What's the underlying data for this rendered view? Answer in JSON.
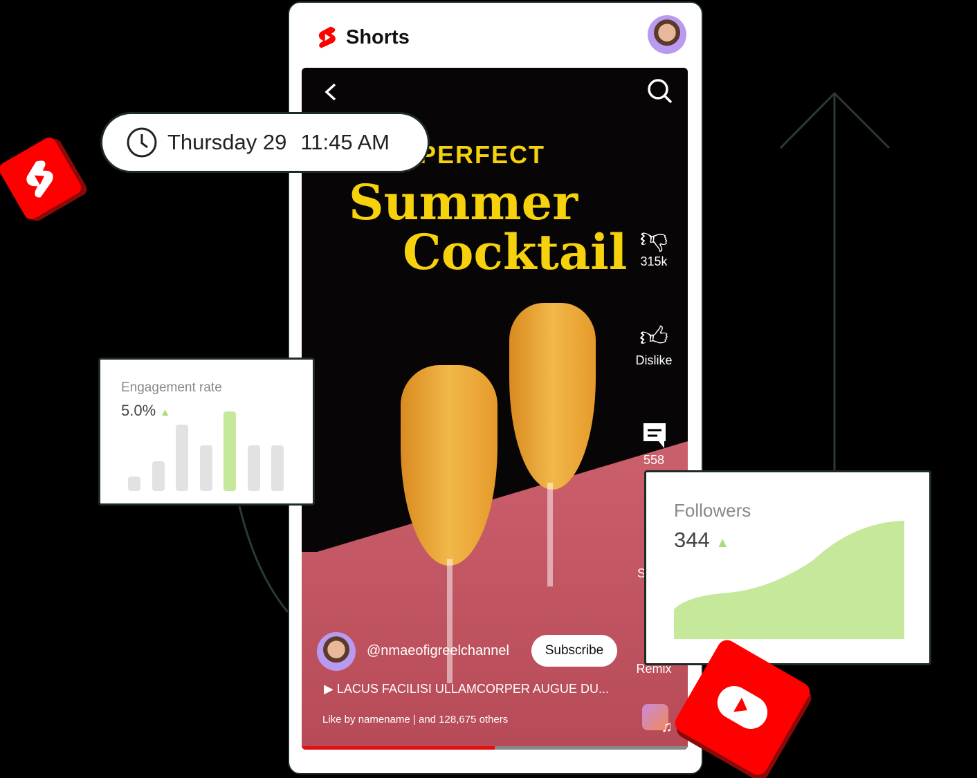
{
  "app": {
    "title": "Shorts"
  },
  "video": {
    "title_small": "PERFECT",
    "title_line1": "Summer",
    "title_line2": "Cocktail",
    "actions": [
      {
        "icon": "thumbs-down-icon",
        "label": "315k"
      },
      {
        "icon": "thumbs-up-icon",
        "label": "Dislike"
      },
      {
        "icon": "comment-icon",
        "label": "558"
      },
      {
        "icon": "share-icon",
        "label": "Share"
      },
      {
        "icon": "remix-icon",
        "label": "Remix"
      }
    ],
    "channel": "@nmaeofigreelchannel",
    "subscribe_label": "Subscribe",
    "caption": "LACUS FACILISI ULLAMCORPER AUGUE DU...",
    "likes_by": "Like by namename",
    "likes_others": "and 128,675 others",
    "progress": 0.5
  },
  "schedule": {
    "day": "Thursday 29",
    "time": "11:45 AM"
  },
  "engagement": {
    "label": "Engagement rate",
    "value": "5.0%",
    "bars": [
      1,
      2,
      4.5,
      3.1,
      5.4,
      3.1,
      3.1
    ],
    "highlight_index": 4
  },
  "followers": {
    "label": "Followers",
    "value": "344"
  },
  "colors": {
    "brand": "#ff0000",
    "accent_green": "#c5e89a",
    "title_yellow": "#f5d20b"
  }
}
